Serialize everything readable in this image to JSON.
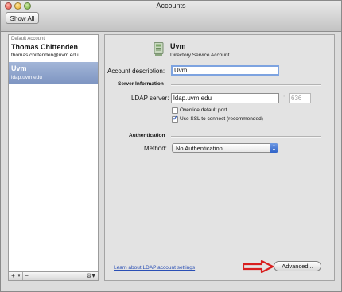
{
  "window": {
    "title": "Accounts",
    "show_all_label": "Show All"
  },
  "sidebar": {
    "header": "Default Account",
    "accounts": [
      {
        "name": "Thomas Chittenden",
        "email": "thomas.chittenden@uvm.edu"
      },
      {
        "name": "Uvm",
        "email": "ldap.uvm.edu"
      }
    ],
    "buttons": {
      "add": "+",
      "remove": "−",
      "gear": "⚙▾"
    }
  },
  "account": {
    "title": "Uvm",
    "subtitle": "Directory Service Account",
    "icon": "ldap-server-icon"
  },
  "form": {
    "description_label": "Account description:",
    "description_value": "Uvm",
    "server_info_header": "Server Information",
    "ldap_server_label": "LDAP server:",
    "ldap_server_value": "ldap.uvm.edu",
    "port_value": "636",
    "override_port_label": "Override default port",
    "override_port_checked": false,
    "ssl_label": "Use SSL to connect (recommended)",
    "ssl_checked": true,
    "auth_header": "Authentication",
    "method_label": "Method:",
    "method_value": "No Authentication"
  },
  "footer": {
    "learn_link": "Learn about LDAP account settings",
    "advanced_label": "Advanced..."
  },
  "colors": {
    "selection": "#8ea3cc",
    "link": "#2a4fb5",
    "annotation_arrow": "#d81e1e"
  }
}
